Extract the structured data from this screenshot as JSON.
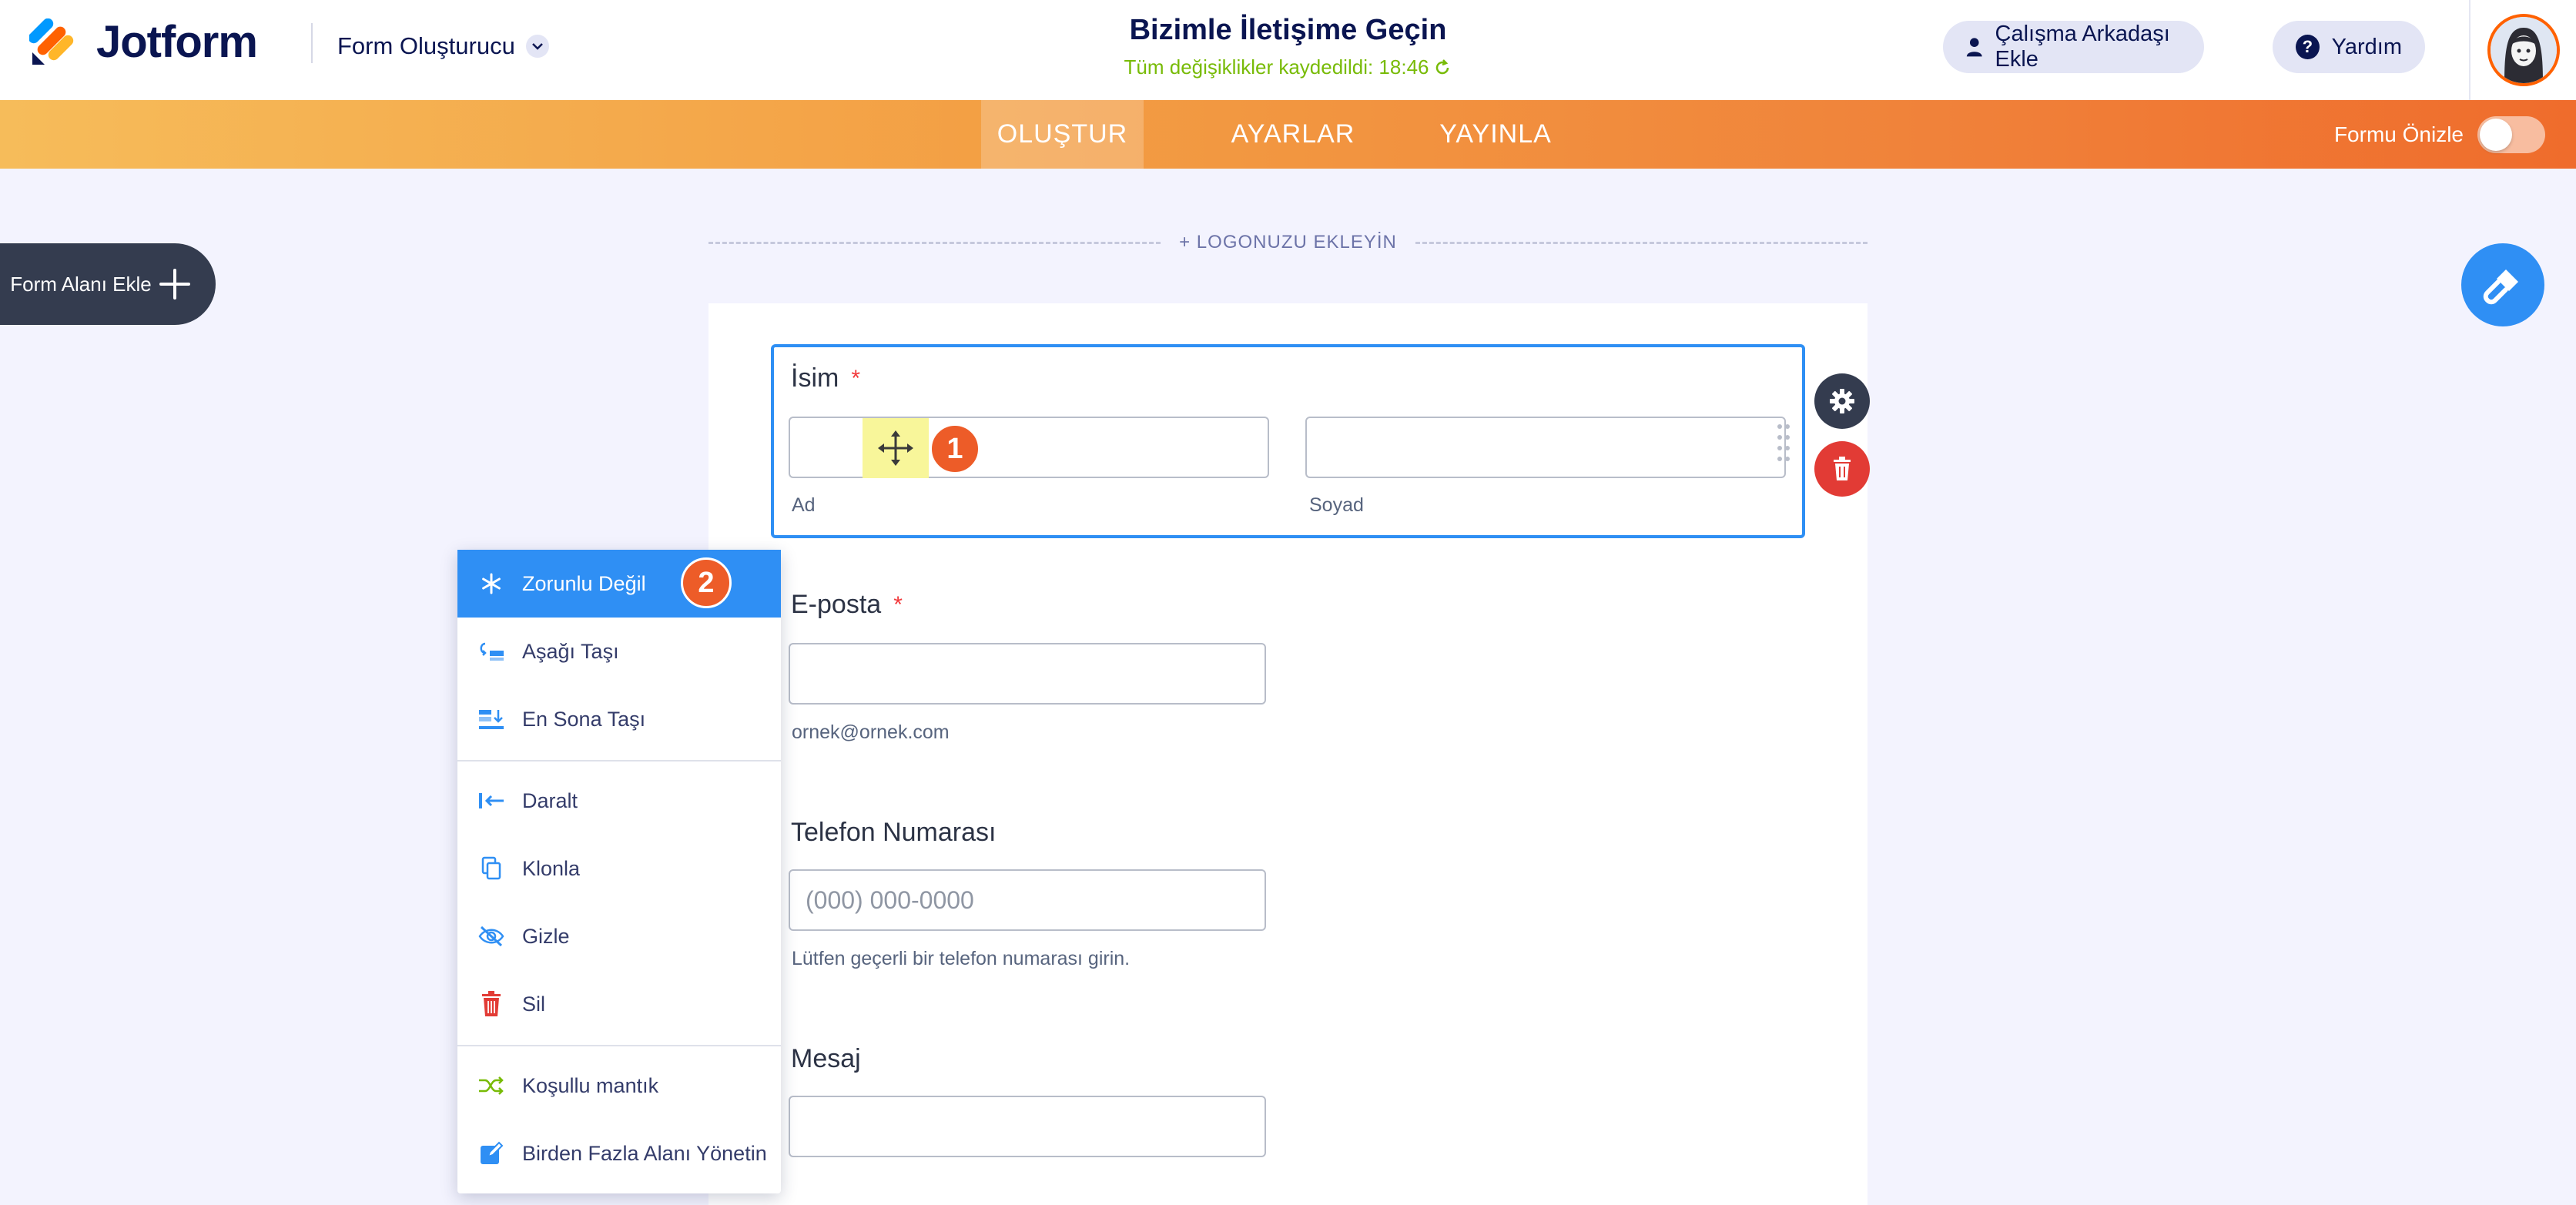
{
  "header": {
    "brand": "Jotform",
    "builder_menu": "Form Oluşturucu",
    "form_title": "Bizimle İletişime Geçin",
    "save_status": "Tüm değişiklikler kaydedildi: 18:46",
    "add_collaborator": "Çalışma Arkadaşı Ekle",
    "help": "Yardım"
  },
  "nav": {
    "tabs": [
      "OLUŞTUR",
      "AYARLAR",
      "YAYINLA"
    ],
    "active_tab": "OLUŞTUR",
    "preview_label": "Formu Önizle",
    "preview_on": false
  },
  "sidebar": {
    "add_field_label": "Form Alanı Ekle"
  },
  "form": {
    "add_logo": "+ LOGONUZU EKLEYİN",
    "required_mark": "*",
    "name": {
      "label": "İsim",
      "first_sub": "Ad",
      "last_sub": "Soyad",
      "first_value": "",
      "last_value": ""
    },
    "email": {
      "label": "E-posta",
      "sublabel": "ornek@ornek.com",
      "value": ""
    },
    "phone": {
      "label": "Telefon Numarası",
      "placeholder": "(000) 000-0000",
      "sublabel": "Lütfen geçerli bir telefon numarası girin."
    },
    "message": {
      "label": "Mesaj",
      "value": ""
    }
  },
  "annotations": {
    "step1": "1",
    "step2": "2"
  },
  "context_menu": {
    "items": [
      {
        "label": "Zorunlu Değil",
        "icon": "asterisk-icon"
      },
      {
        "label": "Aşağı Taşı",
        "icon": "move-down-icon"
      },
      {
        "label": "En Sona Taşı",
        "icon": "move-to-bottom-icon"
      },
      {
        "label": "Daralt",
        "icon": "shrink-icon"
      },
      {
        "label": "Klonla",
        "icon": "clone-icon"
      },
      {
        "label": "Gizle",
        "icon": "hide-icon"
      },
      {
        "label": "Sil",
        "icon": "trash-icon"
      },
      {
        "label": "Koşullu mantık",
        "icon": "conditional-logic-icon"
      },
      {
        "label": "Birden Fazla Alanı Yönetin",
        "icon": "manage-fields-icon"
      }
    ]
  },
  "colors": {
    "brand_navy": "#0a1551",
    "accent_blue": "#2f8ff4",
    "orange": "#ef6c2c",
    "danger_red": "#e23b35",
    "saved_green": "#78bb07"
  }
}
